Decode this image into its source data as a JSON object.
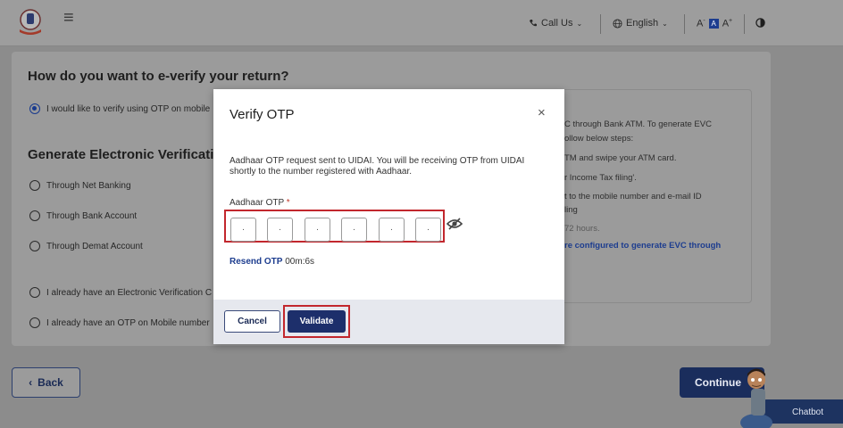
{
  "header": {
    "call_us": "Call Us",
    "language": "English",
    "font_small": "A",
    "font_reset": "A",
    "font_large": "A",
    "font_small_sup": "-",
    "font_large_sup": "+"
  },
  "page": {
    "question_title": "How do you want to e-verify your return?",
    "option_otp_mobile": "I would like to verify using OTP on mobile",
    "generate_title": "Generate Electronic Verificatio",
    "options": [
      "Through Net Banking",
      "Through Bank Account",
      "Through Demat Account",
      "I already have an Electronic Verification C",
      "I already have an OTP on Mobile number"
    ],
    "info_lines": [
      "C through Bank ATM. To generate EVC",
      "ollow below steps:",
      "TM and swipe your ATM card.",
      "r Income Tax filing'.",
      "t to the mobile number and e-mail ID",
      "ling",
      "72 hours.",
      "re configured to generate EVC through"
    ],
    "back_label": "Back",
    "continue_label": "Continue",
    "chatbot_label": "Chatbot"
  },
  "modal": {
    "title": "Verify OTP",
    "close": "×",
    "message": "Aadhaar OTP request sent to UIDAI. You will be receiving OTP from UIDAI shortly to the number registered with Aadhaar.",
    "otp_label": "Aadhaar OTP",
    "otp_required": "*",
    "otp_digits": [
      "·",
      "·",
      "·",
      "·",
      "·",
      "·"
    ],
    "resend_label": "Resend OTP",
    "timer": "00m:6s",
    "cancel_label": "Cancel",
    "validate_label": "Validate"
  },
  "colors": {
    "accent": "#1d2f6b",
    "highlight": "#c2272d",
    "link": "#1d3d8f"
  }
}
